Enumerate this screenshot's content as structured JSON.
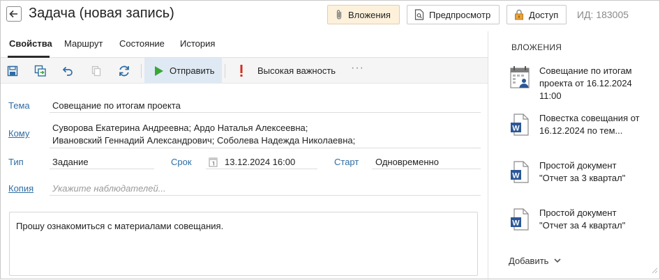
{
  "header": {
    "title": "Задача (новая запись)",
    "attachments_button": "Вложения",
    "preview_button": "Предпросмотр",
    "access_button": "Доступ",
    "id_label": "ИД: 183005"
  },
  "tabs": [
    {
      "label": "Свойства",
      "active": true
    },
    {
      "label": "Маршрут",
      "active": false
    },
    {
      "label": "Состояние",
      "active": false
    },
    {
      "label": "История",
      "active": false
    }
  ],
  "toolbar": {
    "icons": [
      "save-icon",
      "save-and-close-icon",
      "undo-icon",
      "copy-icon",
      "refresh-icon"
    ],
    "send_label": "Отправить",
    "importance_label": "Высокая важность",
    "more_label": "···"
  },
  "form": {
    "subject_label": "Тема",
    "subject_value": "Совещание по итогам проекта",
    "to_label": "Кому",
    "to_line1": "Суворова Екатерина Андреевна; Ардо Наталья Алексеевна;",
    "to_line2": "Ивановский Геннадий Александрович; Соболева Надежда Николаевна;",
    "type_label": "Тип",
    "type_value": "Задание",
    "deadline_label": "Срок",
    "deadline_value": "13.12.2024 16:00",
    "start_label": "Старт",
    "start_value": "Одновременно",
    "copy_label": "Копия",
    "copy_placeholder": "Укажите наблюдателей...",
    "message": "Прошу ознакомиться с материалами совещания."
  },
  "attachments_panel": {
    "title": "ВЛОЖЕНИЯ",
    "items": [
      {
        "icon": "meeting-icon",
        "name": "Совещание по итогам проекта от 16.12.2024 11:00"
      },
      {
        "icon": "word-doc-icon",
        "name": "Повестка совещания от 16.12.2024 по тем..."
      },
      {
        "icon": "word-doc-icon",
        "name": "Простой документ \"Отчет за 3 квартал\""
      },
      {
        "icon": "word-doc-icon",
        "name": "Простой документ \"Отчет за 4 квартал\""
      }
    ],
    "add_label": "Добавить"
  },
  "colors": {
    "link_blue": "#2e6da4",
    "send_bg": "#dfe9f3",
    "attachments_btn_bg": "#fdf1dc",
    "play_green": "#3aa636",
    "importance_red": "#d62d20",
    "word_blue": "#2b5797"
  }
}
